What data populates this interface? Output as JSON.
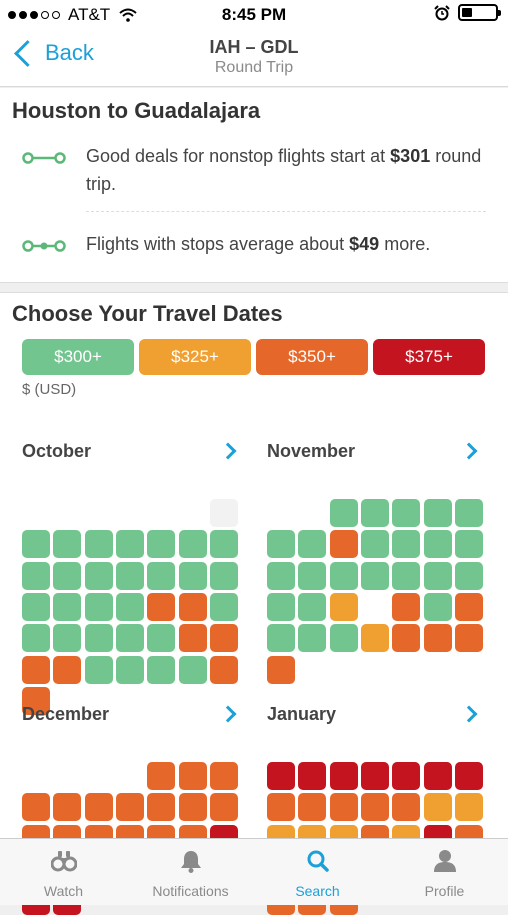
{
  "status": {
    "carrier": "AT&T",
    "time": "8:45 PM"
  },
  "nav": {
    "back_label": "Back",
    "route": "IAH – GDL",
    "trip_type": "Round Trip"
  },
  "summary": {
    "title": "Houston to Guadalajara",
    "nonstop_pre": "Good deals for nonstop flights start at ",
    "nonstop_price": "$301",
    "nonstop_post": " round trip.",
    "stops_pre": "Flights with stops average about ",
    "stops_price": "$49",
    "stops_post": " more."
  },
  "dates": {
    "title": "Choose Your Travel Dates",
    "currency": "$ (USD)",
    "legend": [
      {
        "label": "$300+",
        "color": "#73c58f"
      },
      {
        "label": "$325+",
        "color": "#f0a030"
      },
      {
        "label": "$350+",
        "color": "#e5672a"
      },
      {
        "label": "$375+",
        "color": "#c3141f"
      }
    ],
    "months": [
      {
        "name": "October",
        "start": 6,
        "days": "xggggggggggggggggggooggggggooooggggoo"
      },
      {
        "name": "November",
        "start": 2,
        "days": "gggggggogggggggggggggylogogggyoooo"
      },
      {
        "name": "December",
        "start": 4,
        "days": "oooooooooooooooorrrrrrrrrr"
      },
      {
        "name": "January",
        "start": 0,
        "days": "rrrrrrroooooyyyyyoyrooyyyoooooo"
      }
    ]
  },
  "tabs": [
    {
      "label": "Watch",
      "icon": "binoculars-icon"
    },
    {
      "label": "Notifications",
      "icon": "bell-icon"
    },
    {
      "label": "Search",
      "icon": "search-icon"
    },
    {
      "label": "Profile",
      "icon": "profile-icon"
    }
  ],
  "active_tab": "Search",
  "colors": {
    "accent": "#1ba0d8",
    "green": "#73c58f",
    "yellow": "#f0a030",
    "orange": "#e5672a",
    "red": "#c3141f",
    "empty": "#f2f2f2"
  },
  "battery_level": 0.3
}
